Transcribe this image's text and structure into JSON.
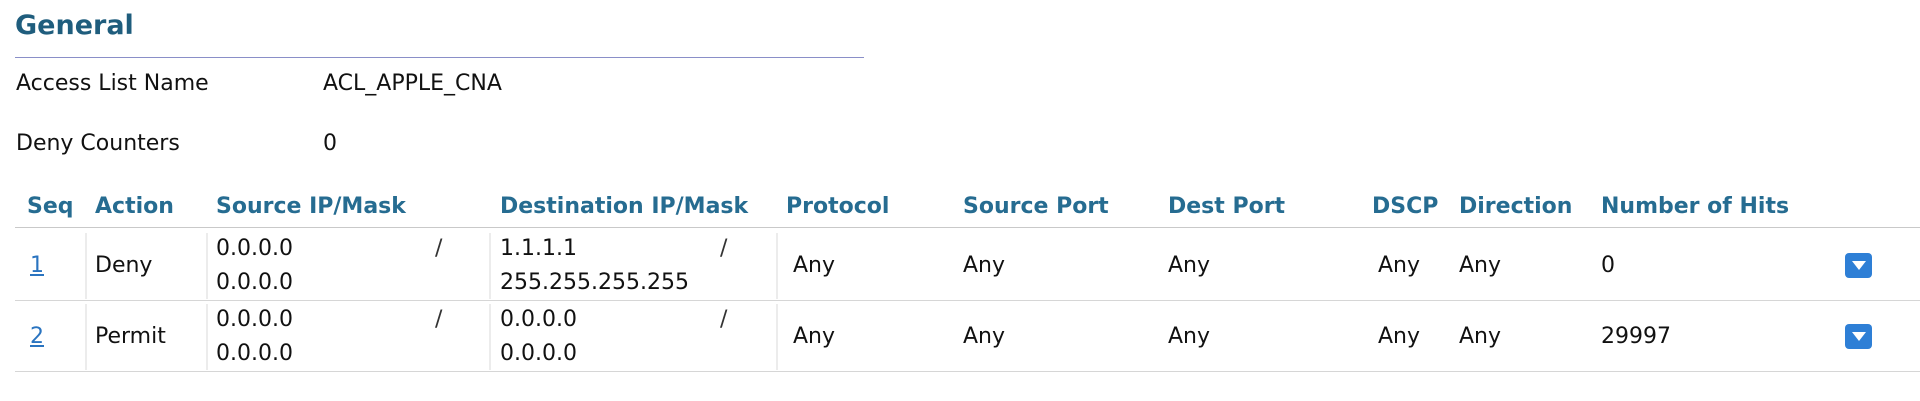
{
  "general": {
    "title": "General",
    "access_list_name_label": "Access List Name",
    "access_list_name_value": "ACL_APPLE_CNA",
    "deny_counters_label": "Deny Counters",
    "deny_counters_value": "0"
  },
  "table": {
    "headers": {
      "seq": "Seq",
      "action": "Action",
      "source": "Source IP/Mask",
      "destination": "Destination IP/Mask",
      "protocol": "Protocol",
      "source_port": "Source Port",
      "dest_port": "Dest Port",
      "dscp": "DSCP",
      "direction": "Direction",
      "hits": "Number of Hits"
    },
    "rows": [
      {
        "seq": "1",
        "action": "Deny",
        "source_ip": "0.0.0.0",
        "source_mask": "0.0.0.0",
        "dest_ip": "1.1.1.1",
        "dest_mask": "255.255.255.255",
        "slash": "/",
        "protocol": "Any",
        "source_port": "Any",
        "dest_port": "Any",
        "dscp": "Any",
        "direction": "Any",
        "hits": "0"
      },
      {
        "seq": "2",
        "action": "Permit",
        "source_ip": "0.0.0.0",
        "source_mask": "0.0.0.0",
        "dest_ip": "0.0.0.0",
        "dest_mask": "0.0.0.0",
        "slash": "/",
        "protocol": "Any",
        "source_port": "Any",
        "dest_port": "Any",
        "dscp": "Any",
        "direction": "Any",
        "hits": "29997"
      }
    ]
  },
  "icons": {
    "row_menu": "chevron-down-icon"
  },
  "colors": {
    "heading": "#1f5d7d",
    "table_header": "#266c91",
    "link": "#2a74c0",
    "menu_button": "#2e7fd6"
  }
}
